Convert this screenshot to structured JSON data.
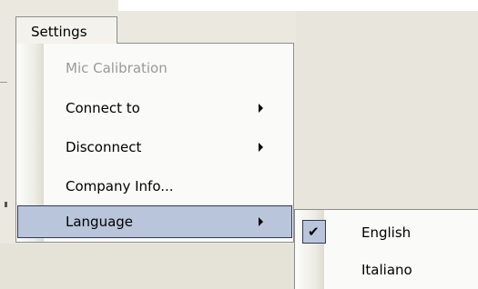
{
  "menubar": {
    "settings_label": "Settings"
  },
  "settings_menu": {
    "items": [
      {
        "label": "Mic Calibration",
        "enabled": false,
        "has_submenu": false
      },
      {
        "label": "Connect to",
        "enabled": true,
        "has_submenu": true
      },
      {
        "label": "Disconnect",
        "enabled": true,
        "has_submenu": true
      },
      {
        "label": "Company Info...",
        "enabled": true,
        "has_submenu": false
      },
      {
        "label": "Language",
        "enabled": true,
        "has_submenu": true,
        "highlighted": true
      }
    ]
  },
  "language_submenu": {
    "items": [
      {
        "label": "English",
        "checked": true
      },
      {
        "label": "Italiano",
        "checked": false
      }
    ]
  },
  "icons": {
    "submenu_arrow": "triangle-right-icon",
    "check": "check-icon"
  },
  "colors": {
    "highlight": "#b8c5db",
    "highlight_border": "#303a5a",
    "disabled_text": "#9a9a95"
  }
}
